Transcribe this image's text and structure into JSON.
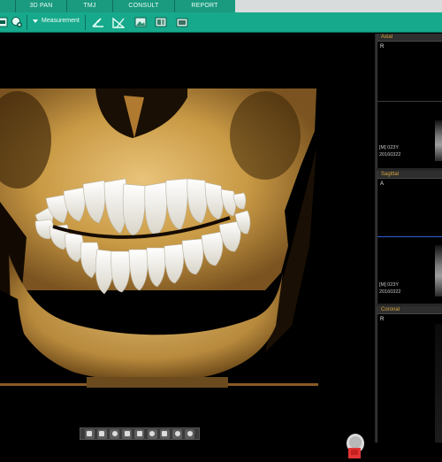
{
  "tabs": [
    {
      "label": "3D PAN"
    },
    {
      "label": "TMJ"
    },
    {
      "label": "CONSULT"
    },
    {
      "label": "REPORT"
    }
  ],
  "toolbar": {
    "measurement_label": "Measurement",
    "icons": [
      "image-settings-icon",
      "face-scan-icon",
      "angle-measure-icon",
      "ruler-measure-icon",
      "image-icon",
      "gallery-icon",
      "capture-icon"
    ]
  },
  "viewport": {
    "bottom_tools": [
      "select",
      "pan",
      "rotate",
      "zoom",
      "sculpt",
      "light",
      "opacity",
      "color",
      "reset"
    ]
  },
  "panels": {
    "axial": {
      "title": "Axial",
      "orientation": "R",
      "info_line1": "[M] 023Y",
      "info_line2": "20160322"
    },
    "sagittal": {
      "title": "Sagittal",
      "orientation": "A",
      "info_line1": "[M] 023Y",
      "info_line2": "20160322"
    },
    "coronal": {
      "title": "Coronal",
      "orientation": "R"
    }
  },
  "colors": {
    "accent_green": "#17a98c",
    "tab_green": "#1a9a7f",
    "panel_title": "#d7a23a",
    "axial_line": "#2f5fd6",
    "bone": "#c99a45"
  }
}
